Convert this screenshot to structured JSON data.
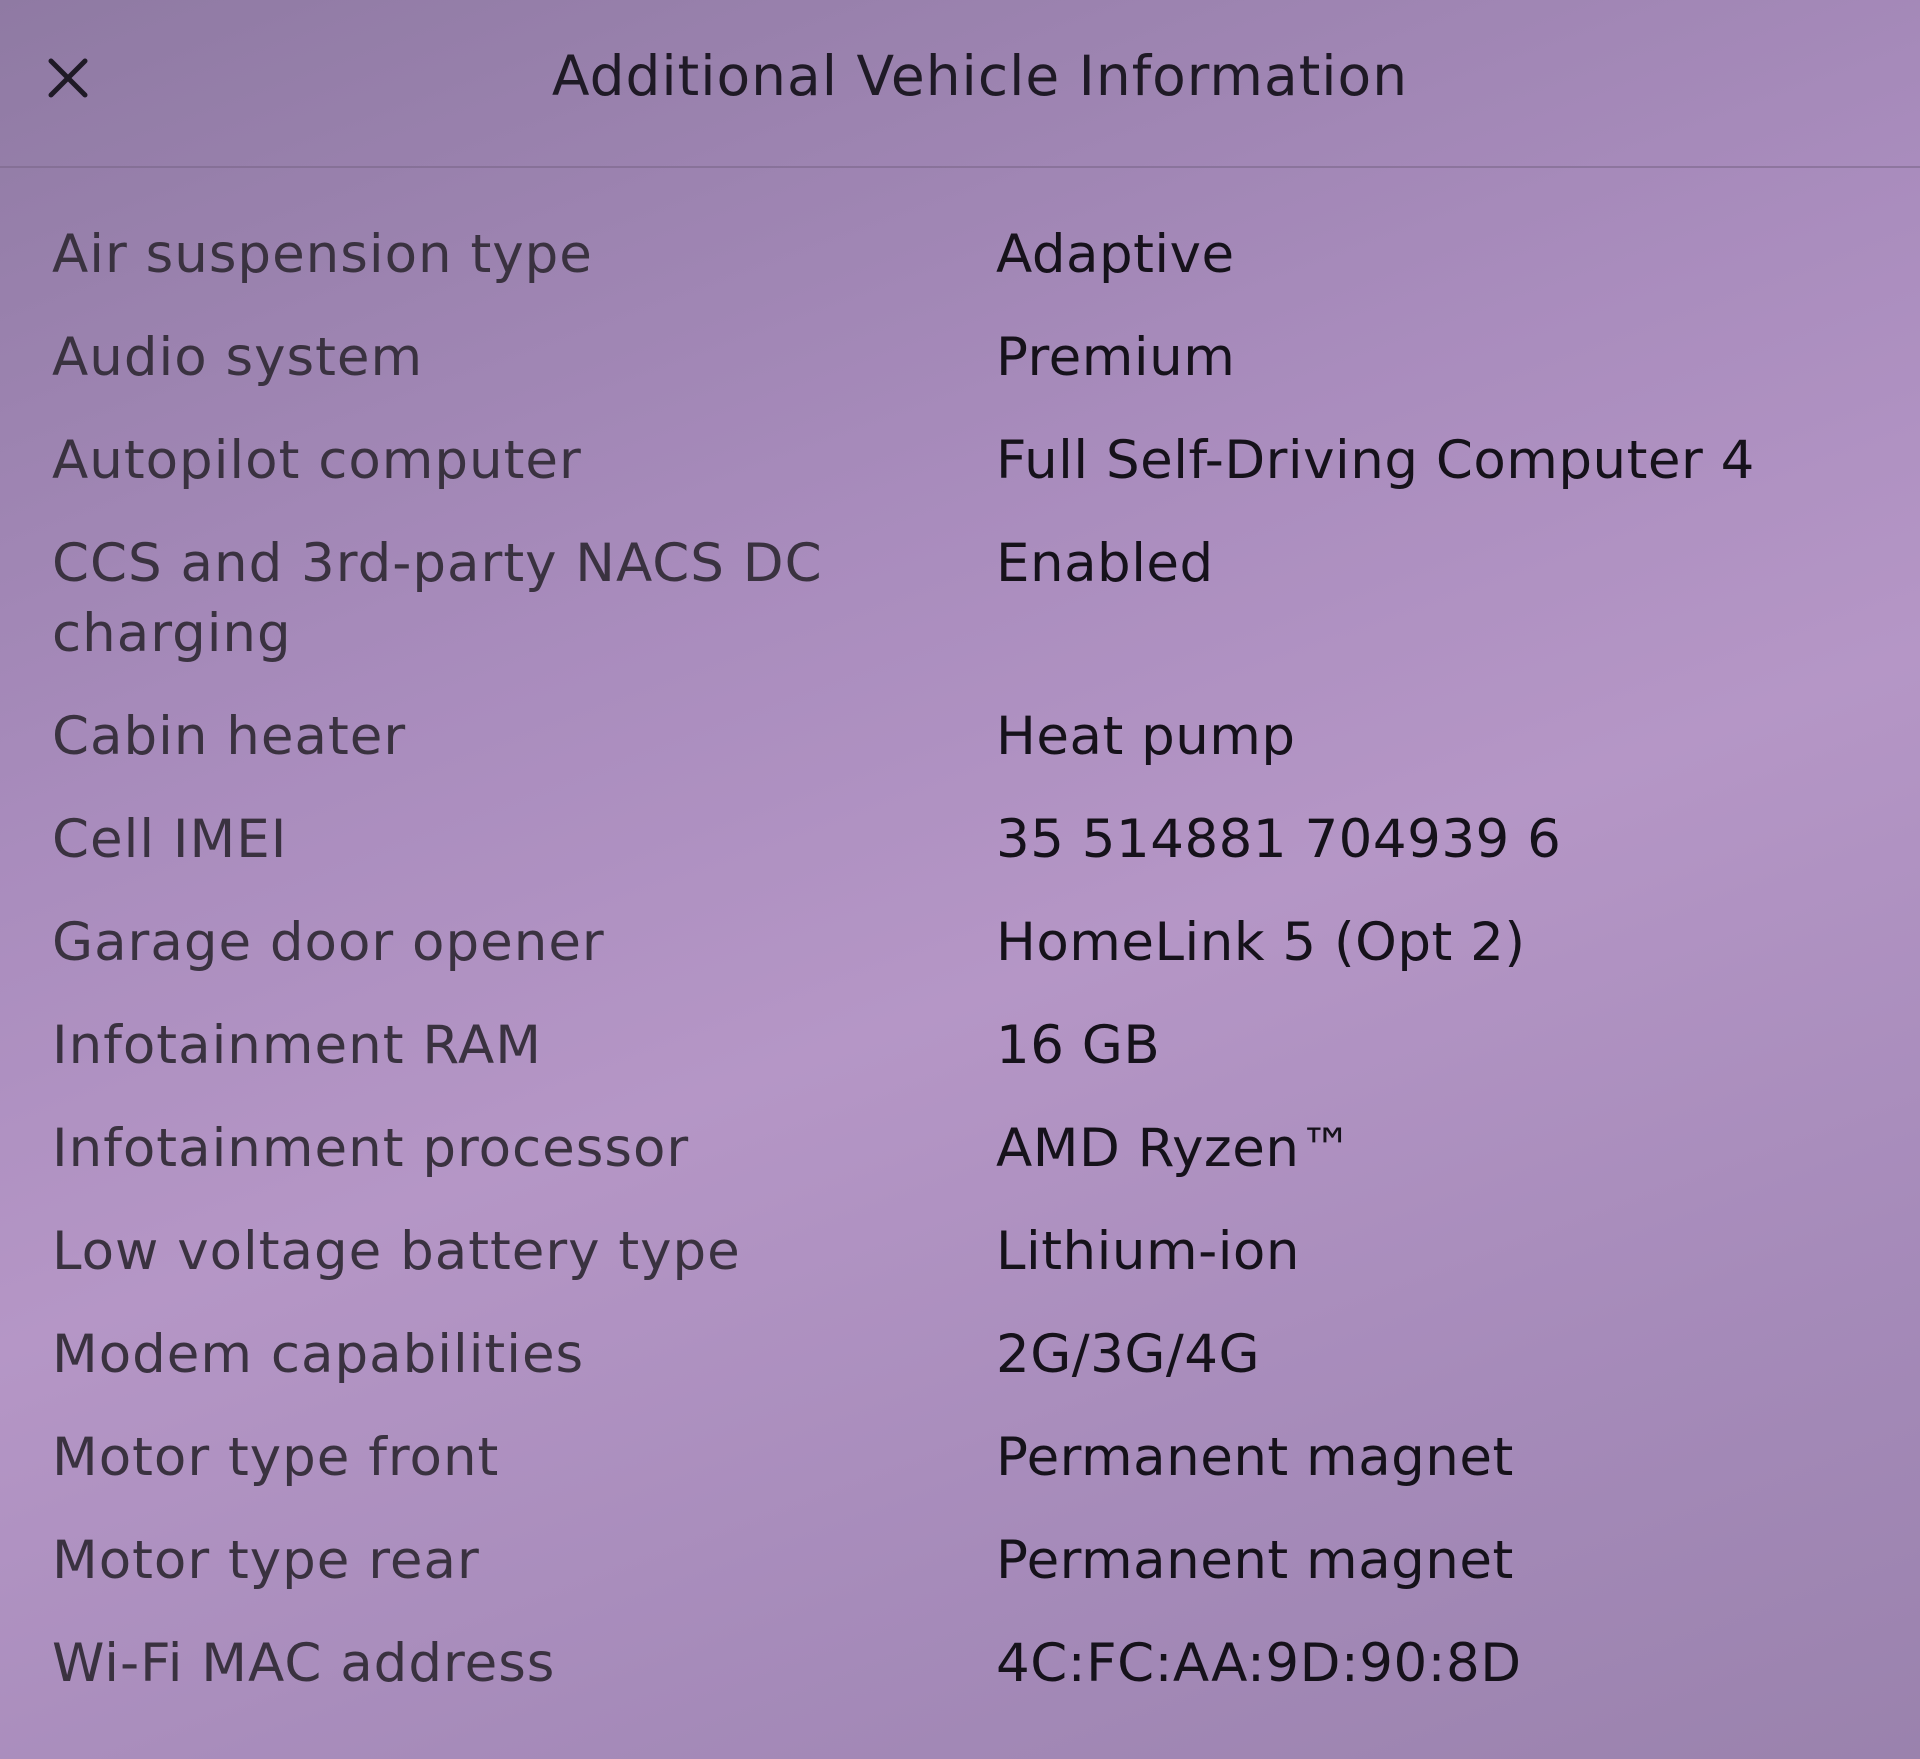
{
  "header": {
    "title": "Additional Vehicle Information",
    "close_icon": "close-icon"
  },
  "rows": [
    {
      "label": "Air suspension type",
      "value": "Adaptive"
    },
    {
      "label": "Audio system",
      "value": "Premium"
    },
    {
      "label": "Autopilot computer",
      "value": "Full Self-Driving Computer 4"
    },
    {
      "label": "CCS and 3rd-party NACS DC charging",
      "value": "Enabled"
    },
    {
      "label": "Cabin heater",
      "value": "Heat pump"
    },
    {
      "label": "Cell IMEI",
      "value": "35 514881 704939 6"
    },
    {
      "label": "Garage door opener",
      "value": "HomeLink 5 (Opt 2)"
    },
    {
      "label": "Infotainment RAM",
      "value": "16 GB"
    },
    {
      "label": "Infotainment processor",
      "value": "AMD Ryzen™"
    },
    {
      "label": "Low voltage battery type",
      "value": "Lithium-ion"
    },
    {
      "label": "Modem capabilities",
      "value": "2G/3G/4G"
    },
    {
      "label": "Motor type front",
      "value": "Permanent magnet"
    },
    {
      "label": "Motor type rear",
      "value": "Permanent magnet"
    },
    {
      "label": "Wi-Fi MAC address",
      "value": "4C:FC:AA:9D:90:8D"
    }
  ]
}
